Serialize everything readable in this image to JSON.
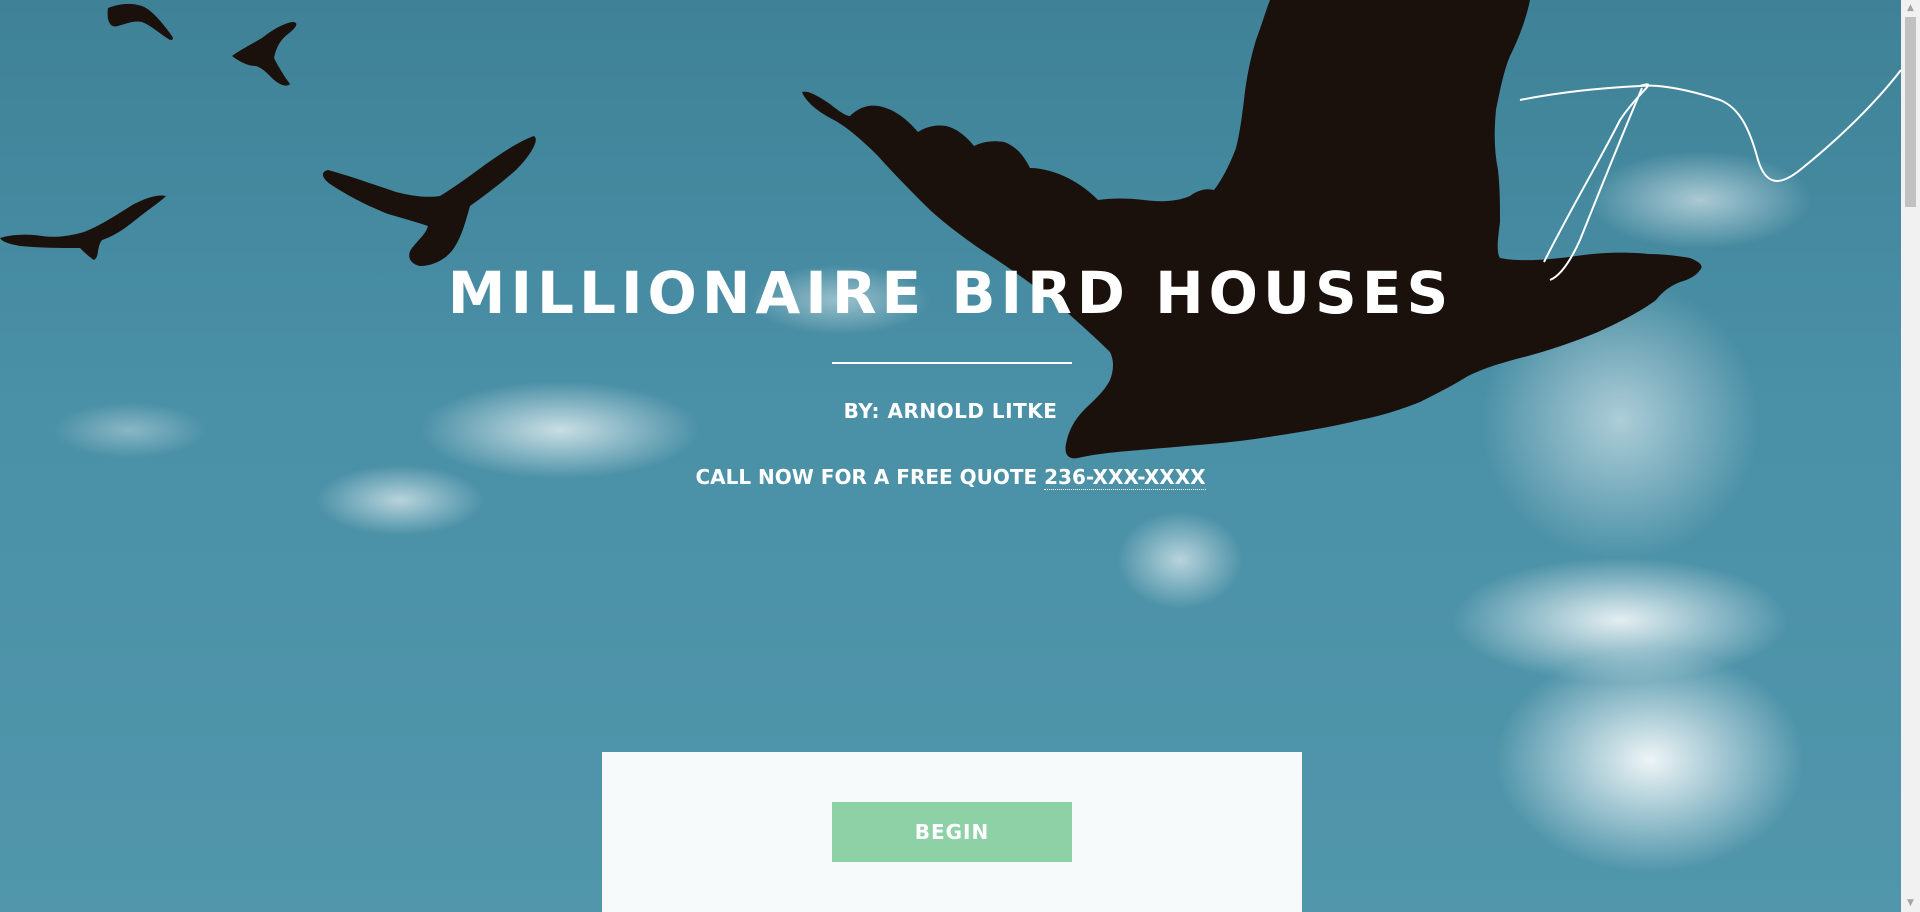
{
  "hero": {
    "title": "MILLIONAIRE BIRD HOUSES",
    "byline": "BY: ARNOLD LITKE",
    "cta_text": "CALL NOW FOR A FREE QUOTE ",
    "phone": "236-XXX-XXXX"
  },
  "panel": {
    "begin_label": "BEGIN"
  },
  "scrollbar": {
    "up_glyph": "▲",
    "down_glyph": "▼"
  },
  "colors": {
    "sky": "#4a90a6",
    "bird": "#1a110d",
    "button": "#8fd1a7",
    "panel": "#ffffff",
    "text": "#ffffff"
  }
}
